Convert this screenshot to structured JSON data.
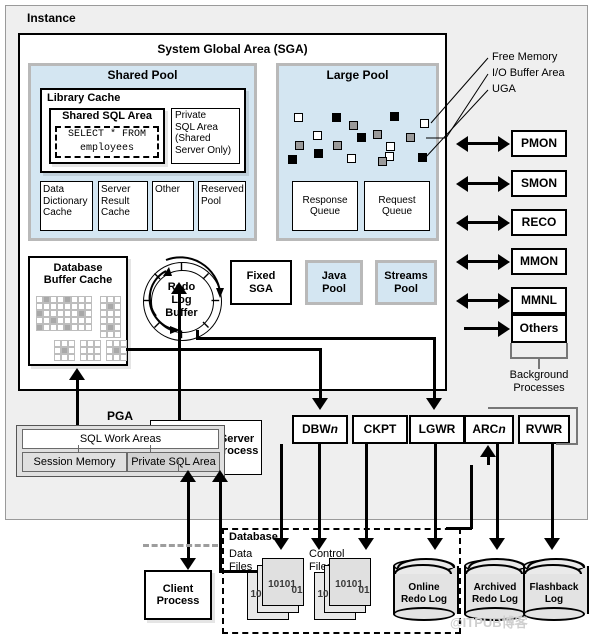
{
  "diagram": {
    "title": "Instance",
    "watermark": "@ITPUB博客",
    "colors": {
      "pool_blue": "#d4e6f2",
      "instance_gray": "#efefef",
      "line_black": "#000000",
      "free_memory": "#ffffff",
      "io_buffer": "#9a9a9a",
      "uga": "#000000"
    }
  },
  "sga": {
    "title": "System Global Area (SGA)",
    "shared_pool": {
      "title": "Shared Pool",
      "library_cache": {
        "title": "Library Cache",
        "shared_sql_area": {
          "title": "Shared SQL Area",
          "sql_line1": "SELECT * FROM",
          "sql_line2": "employees"
        },
        "private_sql_area": "Private\nSQL Area\n(Shared\nServer Only)"
      },
      "sub_boxes": [
        "Data\nDictionary\nCache",
        "Server\nResult\nCache",
        "Other",
        "Reserved\nPool"
      ]
    },
    "large_pool": {
      "title": "Large Pool",
      "response_queue": "Response\nQueue",
      "request_queue": "Request\nQueue",
      "legend": [
        {
          "label": "Free Memory",
          "kind": "free"
        },
        {
          "label": "I/O Buffer Area",
          "kind": "io"
        },
        {
          "label": "UGA",
          "kind": "uga"
        }
      ]
    },
    "buffer_cache": "Database\nBuffer Cache",
    "redo_log_buffer": "Redo\nLog\nBuffer",
    "fixed_sga": "Fixed\nSGA",
    "java_pool": "Java\nPool",
    "streams_pool": "Streams\nPool"
  },
  "pga": {
    "title": "PGA",
    "sql_work_areas": "SQL Work Areas",
    "session_memory": "Session Memory",
    "private_sql_area": "Private SQL Area",
    "server_process": "Server\nProcess"
  },
  "background_processes": {
    "caption": "Background\nProcesses",
    "items": [
      "PMON",
      "SMON",
      "RECO",
      "MMON",
      "MMNL",
      "Others"
    ]
  },
  "writer_processes": [
    {
      "name": "DBW",
      "italic_suffix": "n"
    },
    {
      "name": "CKPT",
      "italic_suffix": ""
    },
    {
      "name": "LGWR",
      "italic_suffix": ""
    },
    {
      "name": "ARC",
      "italic_suffix": "n"
    },
    {
      "name": "RVWR",
      "italic_suffix": ""
    }
  ],
  "client": {
    "label": "Client\nProcess"
  },
  "database": {
    "title": "Database",
    "data_files": "Data\nFiles",
    "control_files": "Control\nFiles",
    "file_digits": "10101",
    "file_digits_small": "10",
    "file_digits_tail": "01",
    "online_redo_log": "Online\nRedo Log",
    "archived_redo_log": "Archived\nRedo Log",
    "flashback_log": "Flashback\nLog"
  }
}
